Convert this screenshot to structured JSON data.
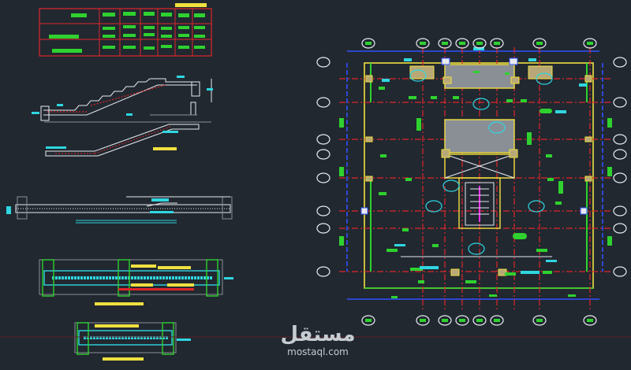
{
  "app": {
    "background": "#212830"
  },
  "colors": {
    "red": "#e0262a",
    "yellow": "#f0e040",
    "green": "#2fd12f",
    "cyan": "#2fd6e0",
    "blue": "#3050ff",
    "magenta": "#ff30ff",
    "white": "#e8eaf0",
    "gray": "#8a8f96",
    "tan": "#b8a878"
  },
  "watermark": {
    "arabic": "مستقل",
    "latin": "mostaql.com"
  },
  "grid_bubbles": {
    "top": [
      "○",
      "○",
      "○",
      "○",
      "○",
      "○",
      "○",
      "○"
    ],
    "bottom": [
      "○",
      "○",
      "○",
      "○",
      "○",
      "○",
      "○",
      "○"
    ],
    "left": [
      "○",
      "○",
      "○",
      "○",
      "○",
      "○",
      "○"
    ],
    "right": [
      "○",
      "○",
      "○",
      "○",
      "○",
      "○",
      "○"
    ]
  },
  "icons": {
    "bubble": "grid-bubble-icon",
    "column": "column-icon",
    "stair": "stair-icon"
  }
}
